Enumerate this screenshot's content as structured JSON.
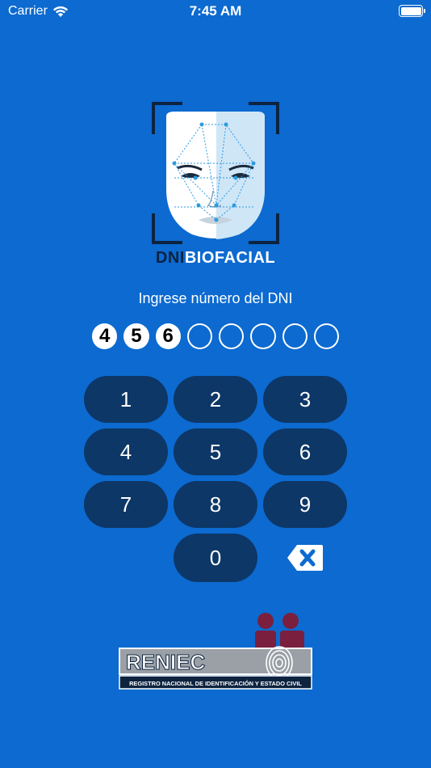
{
  "status_bar": {
    "carrier": "Carrier",
    "time": "7:45 AM"
  },
  "logo": {
    "part_dni": "DNI",
    "part_bio": "BIO",
    "part_facial": "FACIAL"
  },
  "prompt": "Ingrese número del DNI",
  "pin": {
    "digits": [
      "4",
      "5",
      "6",
      "",
      "",
      "",
      "",
      ""
    ]
  },
  "keypad": {
    "keys": [
      "1",
      "2",
      "3",
      "4",
      "5",
      "6",
      "7",
      "8",
      "9",
      "0"
    ]
  },
  "footer": {
    "brand": "RENIEC",
    "subtitle": "REGISTRO NACIONAL DE IDENTIFICACIÓN Y ESTADO CIVIL"
  },
  "colors": {
    "background": "#0c6ad0",
    "key": "#0d3766",
    "logo_dark": "#0d2340",
    "reniec_maroon": "#7a1f3d",
    "reniec_grey": "#9aa0a6"
  }
}
